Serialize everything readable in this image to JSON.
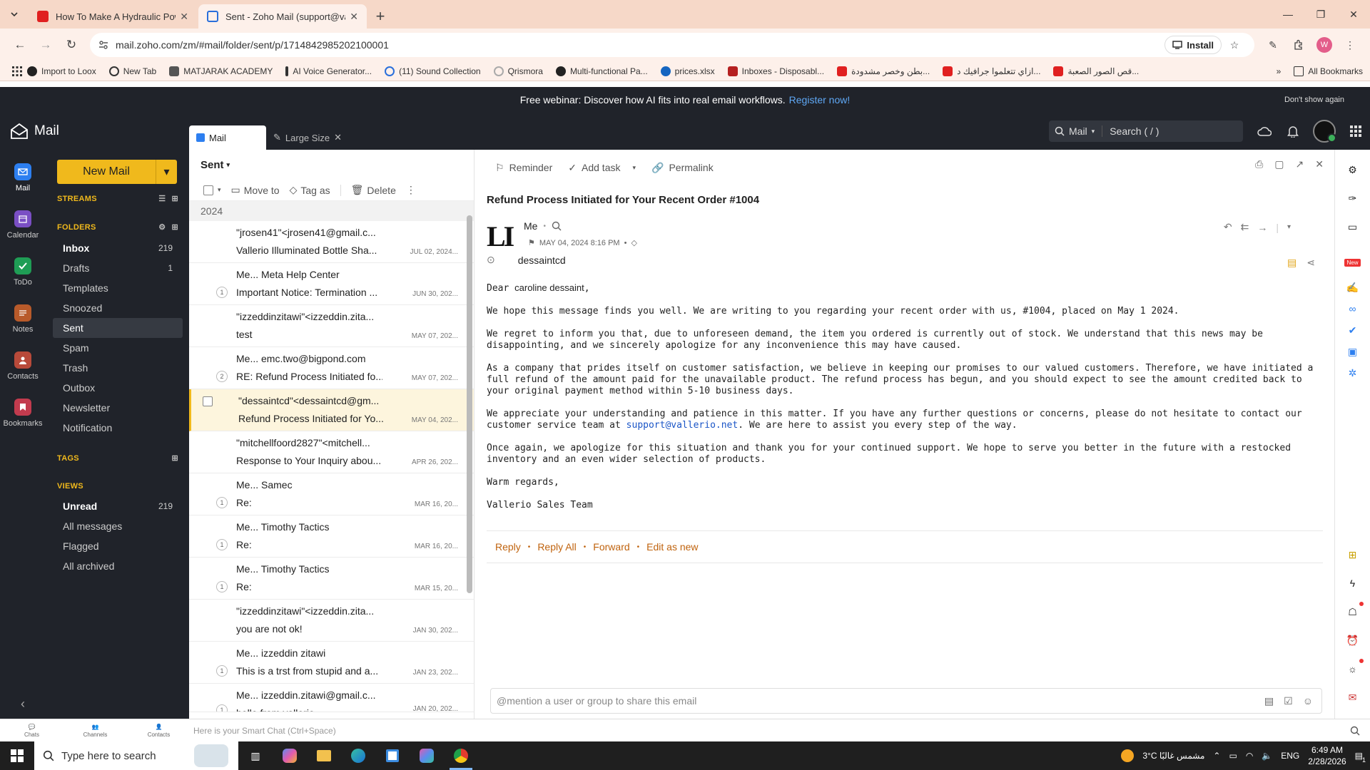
{
  "browser": {
    "tabs": [
      {
        "title": "How To Make A Hydraulic Powe",
        "favicon_color": "#e02020"
      },
      {
        "title": "Sent - Zoho Mail (support@vall",
        "favicon_color": "#2a6fdb"
      }
    ],
    "url": "mail.zoho.com/zm/#mail/folder/sent/p/1714842985202100001",
    "install_label": "Install",
    "profile_initial": "W",
    "bookmarks": [
      {
        "label": "Import to Loox"
      },
      {
        "label": "New Tab"
      },
      {
        "label": "MATJARAK ACADEMY"
      },
      {
        "label": "AI Voice Generator..."
      },
      {
        "label": "(11) Sound Collection"
      },
      {
        "label": "Qrismora"
      },
      {
        "label": "Multi-functional Pa..."
      },
      {
        "label": "prices.xlsx"
      },
      {
        "label": "Inboxes - Disposabl..."
      },
      {
        "label": "بطن وخصر مشدودة..."
      },
      {
        "label": "ازاي تتعلموا جرافيك د..."
      },
      {
        "label": "قص الصور الصعبة..."
      }
    ],
    "all_bookmarks": "All Bookmarks"
  },
  "banner": {
    "text": "Free webinar: Discover how AI fits into real email workflows.",
    "link": "Register now!",
    "dismiss": "Don't show again"
  },
  "app": {
    "brand": "Mail",
    "tabs": [
      {
        "label": "Mail"
      },
      {
        "label": "Large Size"
      }
    ],
    "search_scope": "Mail",
    "search_placeholder": "Search ( / )"
  },
  "rail": [
    {
      "label": "Mail",
      "color": "#2d7ff0"
    },
    {
      "label": "Calendar",
      "color": "#7a4fc4"
    },
    {
      "label": "ToDo",
      "color": "#1f9d55"
    },
    {
      "label": "Notes",
      "color": "#b85a2a"
    },
    {
      "label": "Contacts",
      "color": "#b84a3a"
    },
    {
      "label": "Bookmarks",
      "color": "#c23b4e"
    }
  ],
  "folders_panel": {
    "new_mail": "New Mail",
    "streams": "STREAMS",
    "folders_title": "FOLDERS",
    "folders": [
      {
        "label": "Inbox",
        "count": "219"
      },
      {
        "label": "Drafts",
        "count": "1"
      },
      {
        "label": "Templates",
        "count": ""
      },
      {
        "label": "Snoozed",
        "count": ""
      },
      {
        "label": "Sent",
        "count": ""
      },
      {
        "label": "Spam",
        "count": ""
      },
      {
        "label": "Trash",
        "count": ""
      },
      {
        "label": "Outbox",
        "count": ""
      },
      {
        "label": "Newsletter",
        "count": ""
      },
      {
        "label": "Notification",
        "count": ""
      }
    ],
    "tags_title": "TAGS",
    "views_title": "VIEWS",
    "views": [
      {
        "label": "Unread",
        "count": "219"
      },
      {
        "label": "All messages",
        "count": ""
      },
      {
        "label": "Flagged",
        "count": ""
      },
      {
        "label": "All archived",
        "count": ""
      }
    ]
  },
  "list": {
    "folder": "Sent",
    "toolbar": {
      "move": "Move to",
      "tag": "Tag as",
      "delete": "Delete"
    },
    "year": "2024",
    "rows": [
      {
        "from": "\"jrosen41\"<jrosen41@gmail.c...",
        "subject": "Vallerio Illuminated Bottle Sha...",
        "date": "JUL 02, 2024...",
        "thread": ""
      },
      {
        "from": "Me... Meta Help Center",
        "subject": "Important Notice: Termination ...",
        "date": "JUN 30, 202...",
        "thread": "1"
      },
      {
        "from": "\"izzeddinzitawi\"<izzeddin.zita...",
        "subject": "test",
        "date": "MAY 07, 202...",
        "thread": ""
      },
      {
        "from": "Me... emc.two@bigpond.com",
        "subject": "RE: Refund Process Initiated fo...",
        "date": "MAY 07, 202...",
        "thread": "2"
      },
      {
        "from": "\"dessaintcd\"<dessaintcd@gm...",
        "subject": "Refund Process Initiated for Yo...",
        "date": "MAY 04, 202...",
        "thread": ""
      },
      {
        "from": "\"mitchellfoord2827\"<mitchell...",
        "subject": "Response to Your Inquiry abou...",
        "date": "APR 26, 202...",
        "thread": ""
      },
      {
        "from": "Me... Samec",
        "subject": "Re:",
        "date": "MAR 16, 20...",
        "thread": "1"
      },
      {
        "from": "Me... Timothy Tactics",
        "subject": "Re:",
        "date": "MAR 16, 20...",
        "thread": "1"
      },
      {
        "from": "Me... Timothy Tactics",
        "subject": "Re:",
        "date": "MAR 15, 20...",
        "thread": "1"
      },
      {
        "from": "\"izzeddinzitawi\"<izzeddin.zita...",
        "subject": "you are not ok!",
        "date": "JAN 30, 202...",
        "thread": ""
      },
      {
        "from": "Me... izzeddin zitawi",
        "subject": "This is a trst from stupid and a...",
        "date": "JAN 23, 202...",
        "thread": "1"
      },
      {
        "from": "Me... izzeddin.zitawi@gmail.c...",
        "subject": "hello from vallerio",
        "date": "JAN 20, 202...",
        "thread": "1"
      }
    ]
  },
  "reader": {
    "toolbar": {
      "reminder": "Reminder",
      "task": "Add task",
      "permalink": "Permalink"
    },
    "subject": "Refund Process Initiated for Your Recent Order #1004",
    "logo": "LI",
    "sender": "Me",
    "datetime": "MAY 04, 2024 8:16 PM",
    "to": "dessaintcd",
    "greeting_prefix": "Dear ",
    "greeting_name": "caroline dessaint",
    "greeting_suffix": ",",
    "para1": "We hope this message finds you well. We are writing to you regarding your recent order with us, #1004, placed on May 1 2024.",
    "para2": "We regret to inform you that, due to unforeseen demand, the item you ordered is currently out of stock. We understand that this news may be disappointing, and we sincerely apologize for any inconvenience this may have caused.",
    "para3": "As a company that prides itself on customer satisfaction, we believe in keeping our promises to our valued customers. Therefore, we have initiated a full refund of the amount paid for the unavailable product. The refund process has begun, and you should expect to see the amount credited back to your original payment method within 5-10 business days.",
    "para4_a": "We appreciate your understanding and patience in this matter. If you have any further questions or concerns, please do not hesitate to contact our customer service team at ",
    "para4_link": "support@vallerio.net",
    "para4_b": ". We are here to assist you every step of the way.",
    "para5": "Once again, we apologize for this situation and thank you for your continued support. We hope to serve you better in the future with a restocked inventory and an even wider selection of products.",
    "closing": "Warm regards,",
    "signature": "Vallerio Sales Team",
    "actions": {
      "reply": "Reply",
      "reply_all": "Reply All",
      "forward": "Forward",
      "edit": "Edit as new"
    },
    "share_placeholder": "@mention a user or group to share this email"
  },
  "footer": {
    "items": [
      {
        "label": "Chats"
      },
      {
        "label": "Channels"
      },
      {
        "label": "Contacts"
      }
    ],
    "smart_chat": "Here is your Smart Chat (Ctrl+Space)"
  },
  "taskbar": {
    "search": "Type here to search",
    "weather": "3°C مشمس غالبًا",
    "lang": "ENG",
    "time": "6:49 AM",
    "date": "2/28/2026",
    "notif": "1"
  }
}
